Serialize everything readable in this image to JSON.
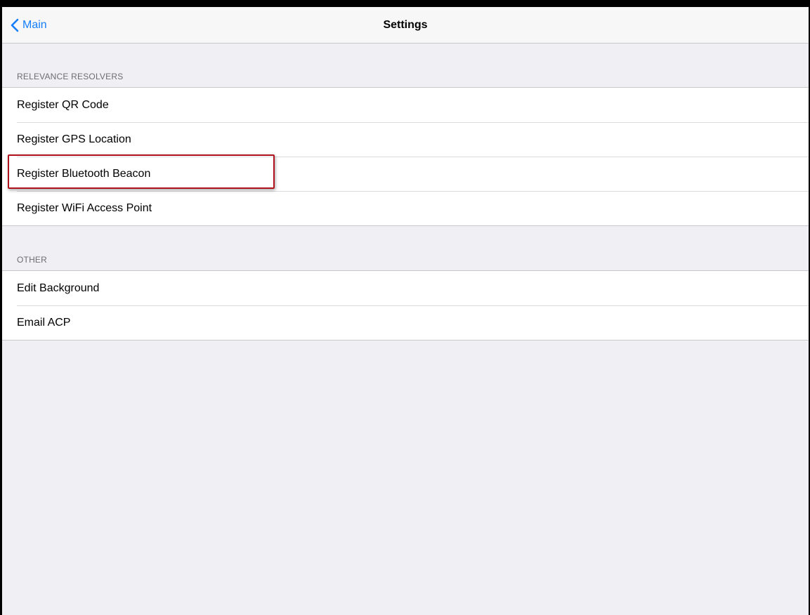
{
  "navbar": {
    "back_label": "Main",
    "back_icon": "chevron-left-icon",
    "title": "Settings"
  },
  "sections": [
    {
      "header": "RELEVANCE RESOLVERS",
      "items": [
        {
          "label": "Register QR Code"
        },
        {
          "label": "Register GPS Location"
        },
        {
          "label": "Register Bluetooth Beacon",
          "highlighted": true
        },
        {
          "label": "Register WiFi Access Point"
        }
      ]
    },
    {
      "header": "OTHER",
      "items": [
        {
          "label": "Edit Background"
        },
        {
          "label": "Email ACP"
        }
      ]
    }
  ],
  "colors": {
    "accent": "#147efb",
    "background": "#efeff4",
    "highlight_border": "#b0121b"
  }
}
